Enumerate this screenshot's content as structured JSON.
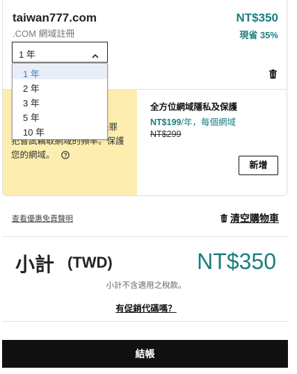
{
  "cart_item": {
    "domain": "taiwan777.com",
    "subtitle": ".COM 網域註冊",
    "price": "NT$350",
    "savings": "現省 35%",
    "term_select": {
      "selected": "1 年",
      "options": [
        "1 年",
        "2 年",
        "3 年",
        "5 年",
        "10 年"
      ],
      "highlighted_index": 0
    }
  },
  "promo_panel": {
    "text_tail": "是罪",
    "text_line2": "犯嘗試竊取網域的頻率。保護",
    "text_line3": "您的網域。"
  },
  "upsell": {
    "title": "全方位網域隱私及保護",
    "price": "NT$199",
    "price_suffix": "/年，每個網域",
    "old_price": "NT$299",
    "add_label": "新增"
  },
  "links": {
    "disclaimer": "查看優惠免責聲明",
    "clear_cart": "清空購物車"
  },
  "summary": {
    "subtotal_label": "小計",
    "currency_label": "(TWD)",
    "total": "NT$350",
    "tax_note": "小計不含適用之稅款。",
    "promo_code_link": "有促銷代碼嗎？"
  },
  "checkout_label": "結帳",
  "colors": {
    "accent": "#1b7d7d",
    "promo_bg": "#fdeeb0",
    "checkout_bg": "#111111"
  },
  "icons": [
    "chevron-up-icon",
    "trash-icon",
    "help-circle-icon"
  ]
}
